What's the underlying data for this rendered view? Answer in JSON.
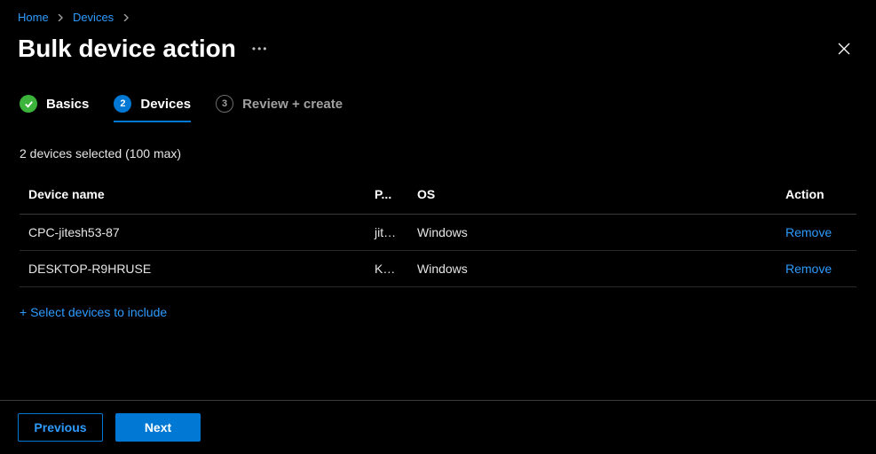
{
  "breadcrumb": {
    "home": "Home",
    "devices": "Devices"
  },
  "header": {
    "title": "Bulk device action"
  },
  "tabs": {
    "basics": {
      "label": "Basics"
    },
    "devices": {
      "num": "2",
      "label": "Devices"
    },
    "review": {
      "num": "3",
      "label": "Review + create"
    }
  },
  "status": "2 devices selected (100 max)",
  "columns": {
    "name": "Device name",
    "p": "P...",
    "os": "OS",
    "action": "Action"
  },
  "rows": [
    {
      "name": "CPC-jitesh53-87",
      "p": "jite...",
      "os": "Windows",
      "action": "Remove"
    },
    {
      "name": "DESKTOP-R9HRUSE",
      "p": "Kan...",
      "os": "Windows",
      "action": "Remove"
    }
  ],
  "select_link": "+ Select devices to include",
  "buttons": {
    "previous": "Previous",
    "next": "Next"
  }
}
